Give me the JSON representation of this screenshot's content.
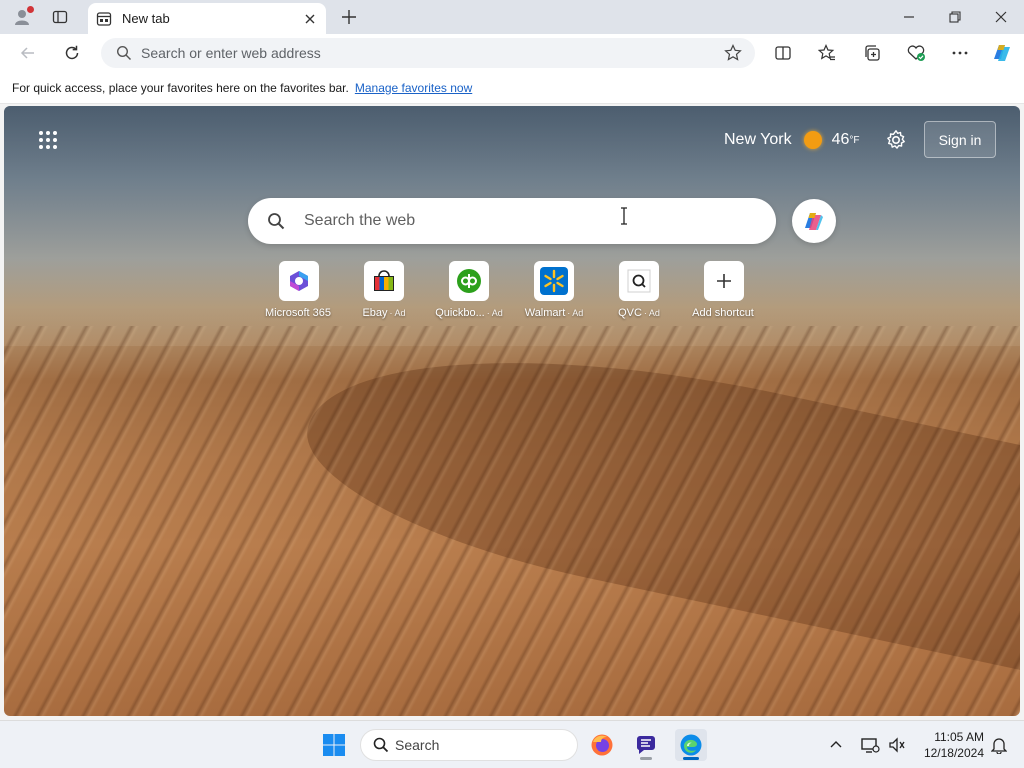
{
  "browser": {
    "tab": {
      "title": "New tab"
    },
    "address_bar": {
      "placeholder": "Search or enter web address"
    },
    "favorites_bar": {
      "message": "For quick access, place your favorites here on the favorites bar.",
      "link": "Manage favorites now"
    }
  },
  "newtab": {
    "weather": {
      "city": "New York",
      "temp": "46",
      "unit": "°F"
    },
    "signin_label": "Sign in",
    "search_placeholder": "Search the web",
    "shortcuts": [
      {
        "label": "Microsoft 365",
        "ad": ""
      },
      {
        "label": "Ebay",
        "ad": "· Ad"
      },
      {
        "label": "Quickbo...",
        "ad": "· Ad"
      },
      {
        "label": "Walmart",
        "ad": "· Ad"
      },
      {
        "label": "QVC",
        "ad": "· Ad"
      },
      {
        "label": "Add shortcut",
        "ad": ""
      }
    ]
  },
  "taskbar": {
    "search_label": "Search",
    "time": "11:05 AM",
    "date": "12/18/2024"
  },
  "colors": {
    "accent": "#0067c0",
    "link": "#1a62c7",
    "notification_dot": "#d13438",
    "weather_sun": "#f39c12"
  },
  "icons": [
    "profile-icon",
    "tab-actions-icon",
    "newtab-page-icon",
    "close-icon",
    "plus-icon",
    "minimize-icon",
    "restore-icon",
    "back-arrow-icon",
    "refresh-icon",
    "search-icon",
    "star-icon",
    "split-screen-icon",
    "favorites-icon",
    "collections-icon",
    "browser-essentials-icon",
    "more-icon",
    "copilot-icon",
    "apps-grid-icon",
    "gear-icon",
    "text-cursor-icon",
    "windows-start-icon",
    "firefox-icon",
    "app-icon",
    "edge-icon",
    "chevron-up-icon",
    "network-icon",
    "notification-bell-icon"
  ]
}
